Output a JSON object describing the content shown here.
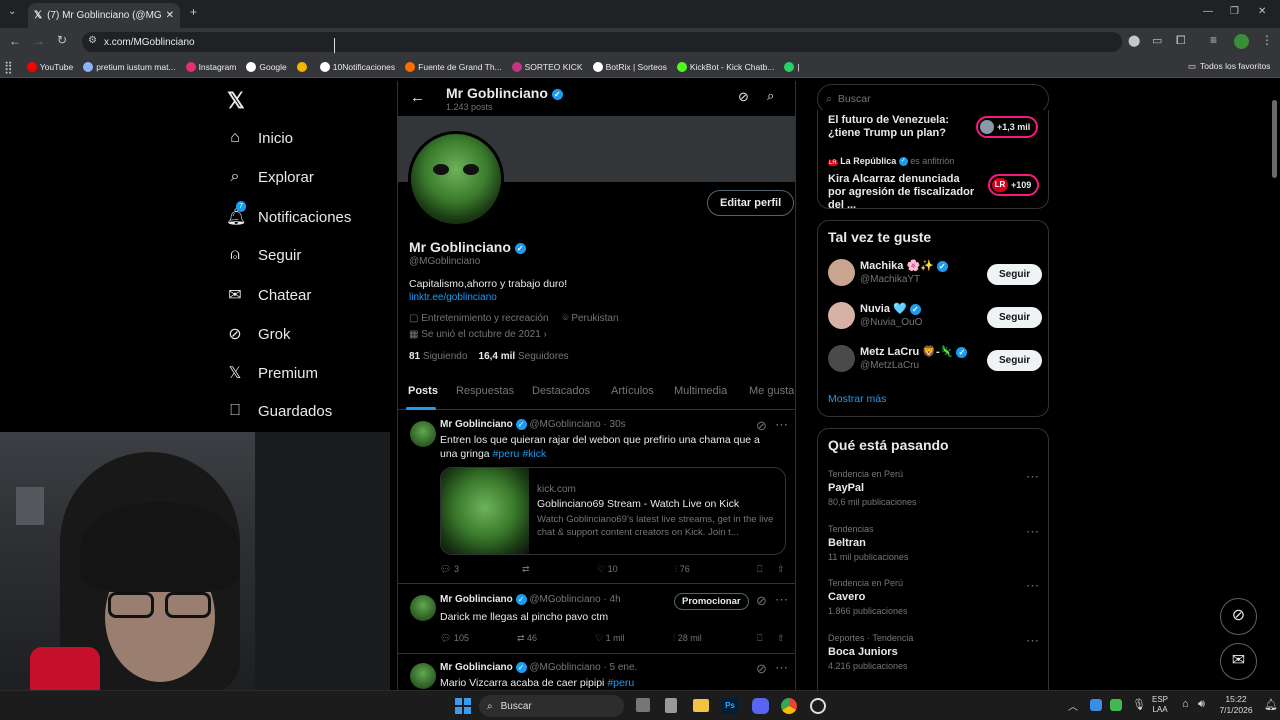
{
  "browser": {
    "tab_title": "(7) Mr Goblinciano (@MGoblinc",
    "url": "x.com/MGoblinciano",
    "bookmarks": [
      {
        "label": "YouTube",
        "color": "#ff0000"
      },
      {
        "label": "pretium iustum mat...",
        "color": "#8ab4f8"
      },
      {
        "label": "Instagram",
        "color": "#e1306c"
      },
      {
        "label": "Google",
        "color": "#ffffff"
      },
      {
        "label": "",
        "color": "#f4b400"
      },
      {
        "label": "10Notificaciones",
        "color": "#ffffff"
      },
      {
        "label": "Fuente de Grand Th...",
        "color": "#ff6d00"
      },
      {
        "label": "SORTEO KICK",
        "color": "#c13584"
      },
      {
        "label": "BotRix | Sorteos",
        "color": "#ffffff"
      },
      {
        "label": "KickBot - Kick Chatb...",
        "color": "#53fc18"
      },
      {
        "label": "|",
        "color": "#25d366"
      }
    ],
    "all_bookmarks": "Todos los favoritos"
  },
  "nav": {
    "items": [
      {
        "label": "Inicio",
        "icon": "home-icon"
      },
      {
        "label": "Explorar",
        "icon": "search-icon"
      },
      {
        "label": "Notificaciones",
        "icon": "bell-icon",
        "badge": "7"
      },
      {
        "label": "Seguir",
        "icon": "follow-icon"
      },
      {
        "label": "Chatear",
        "icon": "mail-icon"
      },
      {
        "label": "Grok",
        "icon": "grok-icon"
      },
      {
        "label": "Premium",
        "icon": "x-icon"
      },
      {
        "label": "Guardados",
        "icon": "bookmark-icon"
      }
    ]
  },
  "profile": {
    "header_name": "Mr Goblinciano",
    "header_posts": "1.243 posts",
    "name": "Mr Goblinciano",
    "handle": "@MGoblinciano",
    "bio": "Capitalismo,ahorro y trabajo duro!",
    "link": "linktr.ee/goblinciano",
    "category": "Entretenimiento y recreación",
    "location": "Perukistan",
    "joined": "Se unió el octubre de 2021",
    "following_count": "81",
    "following_label": "Siguiendo",
    "followers_count": "16,4 mil",
    "followers_label": "Seguidores",
    "edit_button": "Editar perfil",
    "tabs": [
      "Posts",
      "Respuestas",
      "Destacados",
      "Artículos",
      "Multimedia",
      "Me gusta"
    ]
  },
  "tweets": [
    {
      "name": "Mr Goblinciano",
      "handle": "@MGoblinciano",
      "time": "· 30s",
      "text": "Entren los que quieran rajar del webon que prefirio una chama que a una gringa",
      "tags": "#peru #kick",
      "card": {
        "domain": "kick.com",
        "title": "Goblinciano69 Stream - Watch Live on Kick",
        "desc": "Watch Goblinciano69's latest live streams, get in the live chat & support content creators on Kick. Join t..."
      },
      "replies": "3",
      "reposts": "",
      "likes": "10",
      "views": "76"
    },
    {
      "name": "Mr Goblinciano",
      "handle": "@MGoblinciano",
      "time": "· 4h",
      "text": "Darick me llegas al pincho pavo ctm",
      "tags": "",
      "promote": "Promocionar",
      "replies": "105",
      "reposts": "46",
      "likes": "1 mil",
      "views": "28 mil"
    },
    {
      "name": "Mr Goblinciano",
      "handle": "@MGoblinciano",
      "time": "· 5 ene.",
      "text": "Mario Vizcarra acaba de caer pipipi",
      "tags": "#peru"
    }
  ],
  "right": {
    "search_placeholder": "Buscar",
    "news": [
      {
        "title": "El futuro de Venezuela: ¿tiene Trump un plan?",
        "pill": "+1,3 mil"
      },
      {
        "source": "La República",
        "source_extra": "es anfitrión",
        "title": "Kira Alcarraz denunciada por agresión de fiscalizador del ...",
        "pill": "+109",
        "pill_logo": "LR"
      }
    ],
    "suggest_title": "Tal vez te guste",
    "suggestions": [
      {
        "name": "Machika 🌸✨",
        "handle": "@MachikaYT",
        "button": "Seguir"
      },
      {
        "name": "Nuvia 🩵",
        "handle": "@Nuvia_OuO",
        "button": "Seguir"
      },
      {
        "name": "Metz LaCru 🦁-🦎",
        "handle": "@MetzLaCru",
        "button": "Seguir"
      }
    ],
    "show_more": "Mostrar más",
    "trends_title": "Qué está pasando",
    "trends": [
      {
        "label": "Tendencia en Perú",
        "name": "PayPal",
        "count": "80,6 mil publicaciones"
      },
      {
        "label": "Tendencias",
        "name": "Beltran",
        "count": "11 mil publicaciones"
      },
      {
        "label": "Tendencia en Perú",
        "name": "Cavero",
        "count": "1.866 publicaciones"
      },
      {
        "label": "Deportes · Tendencia",
        "name": "Boca Juniors",
        "count": "4.216 publicaciones"
      }
    ]
  },
  "taskbar": {
    "search": "Buscar",
    "lang1": "ESP",
    "lang2": "LAA",
    "time": "15:22",
    "date": "7/1/2026"
  }
}
